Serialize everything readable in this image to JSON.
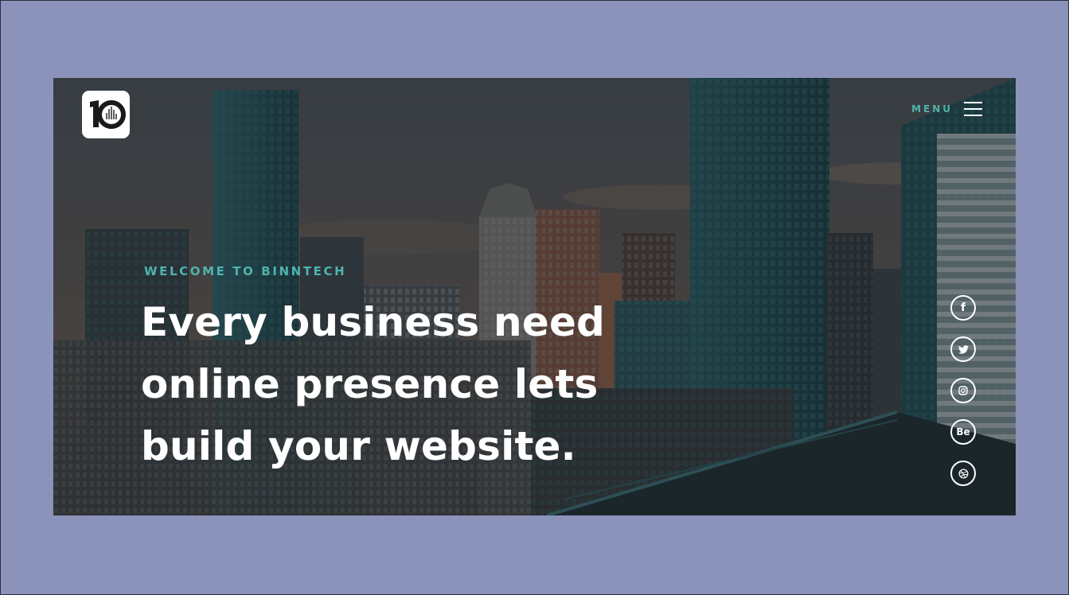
{
  "logo": {
    "text": "10",
    "icon": "brand-logo-icon"
  },
  "header": {
    "menu_label": "MENU",
    "menu_icon": "hamburger-menu-icon"
  },
  "hero": {
    "eyebrow": "WELCOME TO BINNTECH",
    "headline_lines": [
      "Every business need",
      "online presence lets",
      "build your website."
    ],
    "background": "city-skyline-photo"
  },
  "social": {
    "items": [
      {
        "icon": "facebook-icon",
        "label": "f"
      },
      {
        "icon": "twitter-icon",
        "label": ""
      },
      {
        "icon": "instagram-icon",
        "label": ""
      },
      {
        "icon": "behance-icon",
        "label": "Be"
      },
      {
        "icon": "dribbble-icon",
        "label": ""
      }
    ]
  },
  "colors": {
    "page_background": "#8b93bb",
    "accent": "#4fb3ad",
    "text": "#ffffff"
  }
}
